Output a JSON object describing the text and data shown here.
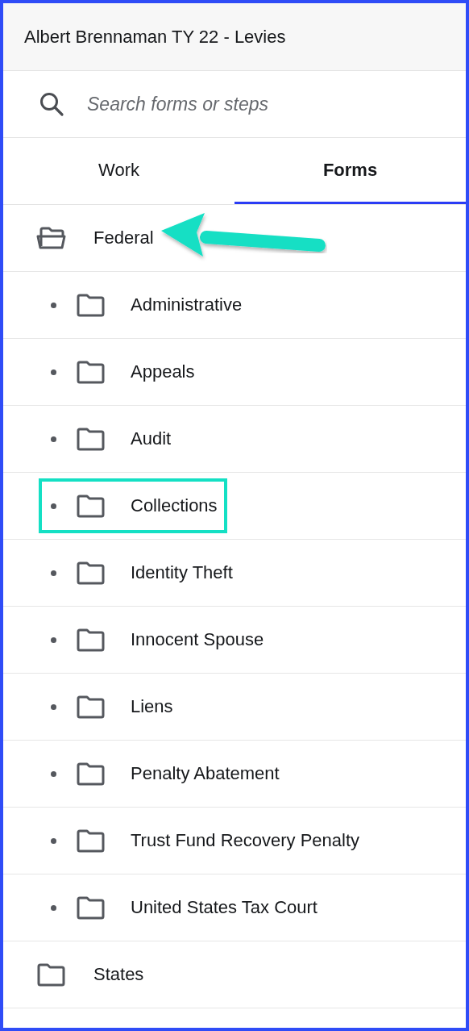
{
  "header": {
    "title": "Albert Brennaman TY 22 - Levies"
  },
  "search": {
    "placeholder": "Search forms or steps"
  },
  "tabs": [
    {
      "label": "Work",
      "selected": false
    },
    {
      "label": "Forms",
      "selected": true
    }
  ],
  "tree": [
    {
      "label": "Federal",
      "expanded": true,
      "arrow": true,
      "children": [
        {
          "label": "Administrative",
          "highlighted": false
        },
        {
          "label": "Appeals",
          "highlighted": false
        },
        {
          "label": "Audit",
          "highlighted": false
        },
        {
          "label": "Collections",
          "highlighted": true
        },
        {
          "label": "Identity Theft",
          "highlighted": false
        },
        {
          "label": "Innocent Spouse",
          "highlighted": false
        },
        {
          "label": "Liens",
          "highlighted": false
        },
        {
          "label": "Penalty Abatement",
          "highlighted": false
        },
        {
          "label": "Trust Fund Recovery Penalty",
          "highlighted": false
        },
        {
          "label": "United States Tax Court",
          "highlighted": false
        }
      ]
    },
    {
      "label": "States",
      "expanded": false,
      "arrow": false
    }
  ]
}
